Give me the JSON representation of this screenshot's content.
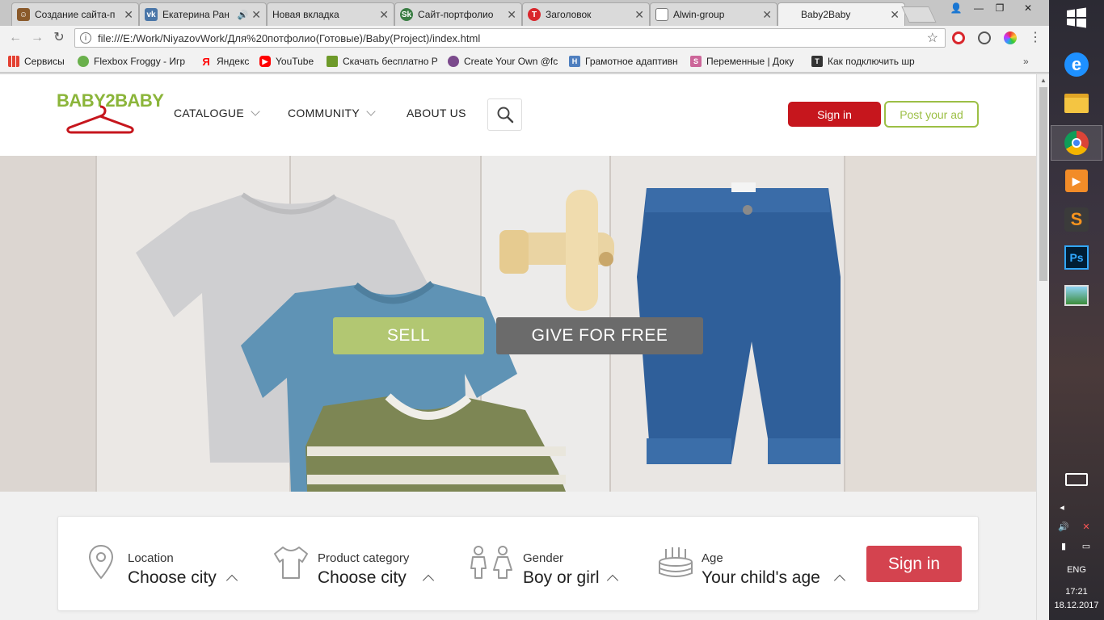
{
  "browser": {
    "tabs": [
      {
        "title": "Создание сайта-п",
        "favicon_color": "#8a5a2b"
      },
      {
        "title": "Екатерина Ран",
        "favicon_color": "#4a76a8"
      },
      {
        "title": "Новая вкладка",
        "favicon_color": ""
      },
      {
        "title": "Сайт-портфолио",
        "favicon_color": "#3a7d44"
      },
      {
        "title": "Заголовок",
        "favicon_color": "#d9262c"
      },
      {
        "title": "Alwin-group",
        "favicon_color": ""
      },
      {
        "title": "Baby2Baby",
        "favicon_color": ""
      }
    ],
    "url": "file:///E:/Work/NiyazovWork/Для%20потфолио(Готовые)/Baby(Project)/index.html",
    "bookmarks": [
      {
        "label": "Сервисы",
        "color": "#e34133"
      },
      {
        "label": "Flexbox Froggy - Игр",
        "color": "#6ab04c"
      },
      {
        "label": "Яндекс",
        "color": "#ff0000"
      },
      {
        "label": "YouTube",
        "color": "#ff0000"
      },
      {
        "label": "Скачать бесплатно Р",
        "color": "#6e9a2a"
      },
      {
        "label": "Create Your Own @fc",
        "color": "#7b4a8c"
      },
      {
        "label": "Грамотное адаптивн",
        "color": "#4f7fbf"
      },
      {
        "label": "Переменные | Доку",
        "color": "#cc6699"
      },
      {
        "label": "Как подключить шр",
        "color": "#333333"
      }
    ]
  },
  "site": {
    "logo_text": "BABY2BABY",
    "nav": [
      {
        "label": "CATALOGUE",
        "has_dropdown": true
      },
      {
        "label": "COMMUNITY",
        "has_dropdown": true
      },
      {
        "label": "ABOUT US",
        "has_dropdown": false
      }
    ],
    "signin_label": "Sign in",
    "post_ad_label": "Post your ad",
    "hero": {
      "sell_label": "SELL",
      "free_label": "GIVE FOR FREE"
    },
    "filters": [
      {
        "label": "Location",
        "value": "Choose city",
        "icon": "location-pin-icon"
      },
      {
        "label": "Product category",
        "value": "Choose city",
        "icon": "tshirt-icon"
      },
      {
        "label": "Gender",
        "value": "Boy or girl",
        "icon": "boy-girl-icon"
      },
      {
        "label": "Age",
        "value": "Your child's age",
        "icon": "birthday-cake-icon"
      }
    ],
    "filter_button_label": "Sign in"
  },
  "colors": {
    "brand_green": "#8bb53a",
    "brand_red": "#c6161d",
    "sell_green": "#b2c772",
    "free_gray": "#6b6b6b",
    "filter_red": "#d4434f"
  },
  "taskbar": {
    "language": "ENG",
    "time": "17:21",
    "date": "18.12.2017"
  }
}
